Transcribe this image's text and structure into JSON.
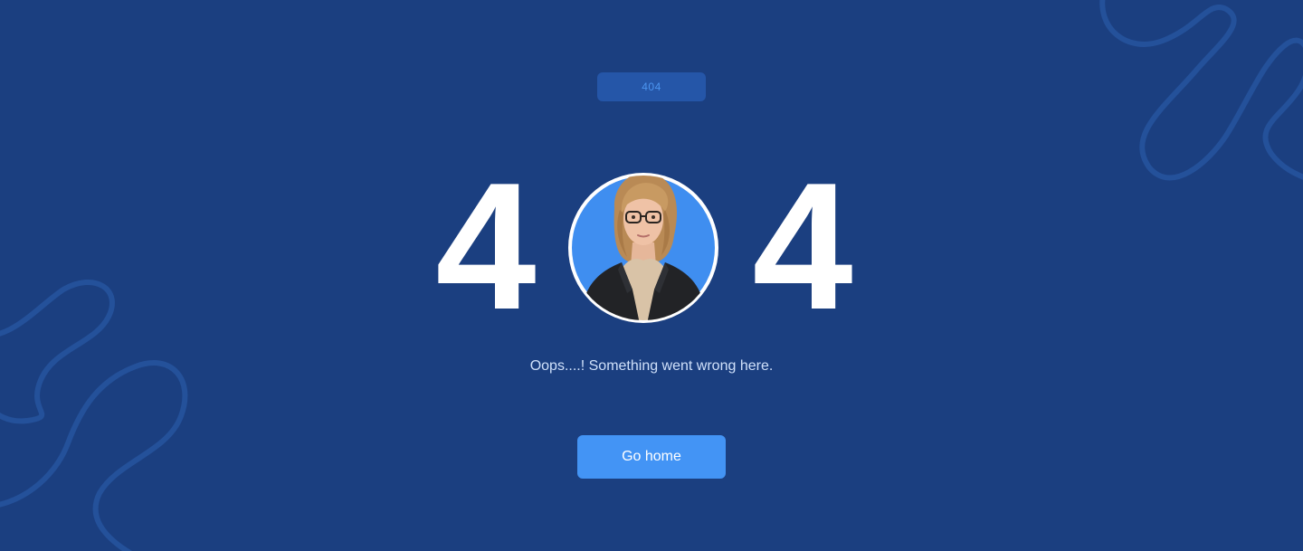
{
  "badge": {
    "label": "404"
  },
  "error_code": {
    "first_digit": "4",
    "last_digit": "4"
  },
  "message": "Oops....! Something went wrong here.",
  "home_button": {
    "label": "Go home"
  },
  "colors": {
    "background": "#1b3f80",
    "badge_bg": "#2556a8",
    "badge_text": "#4c95f0",
    "button_bg": "#4394f5",
    "avatar_bg": "#3f8ef0",
    "decoration": "#24519a"
  },
  "icons": {
    "avatar": "person-portrait-icon"
  }
}
